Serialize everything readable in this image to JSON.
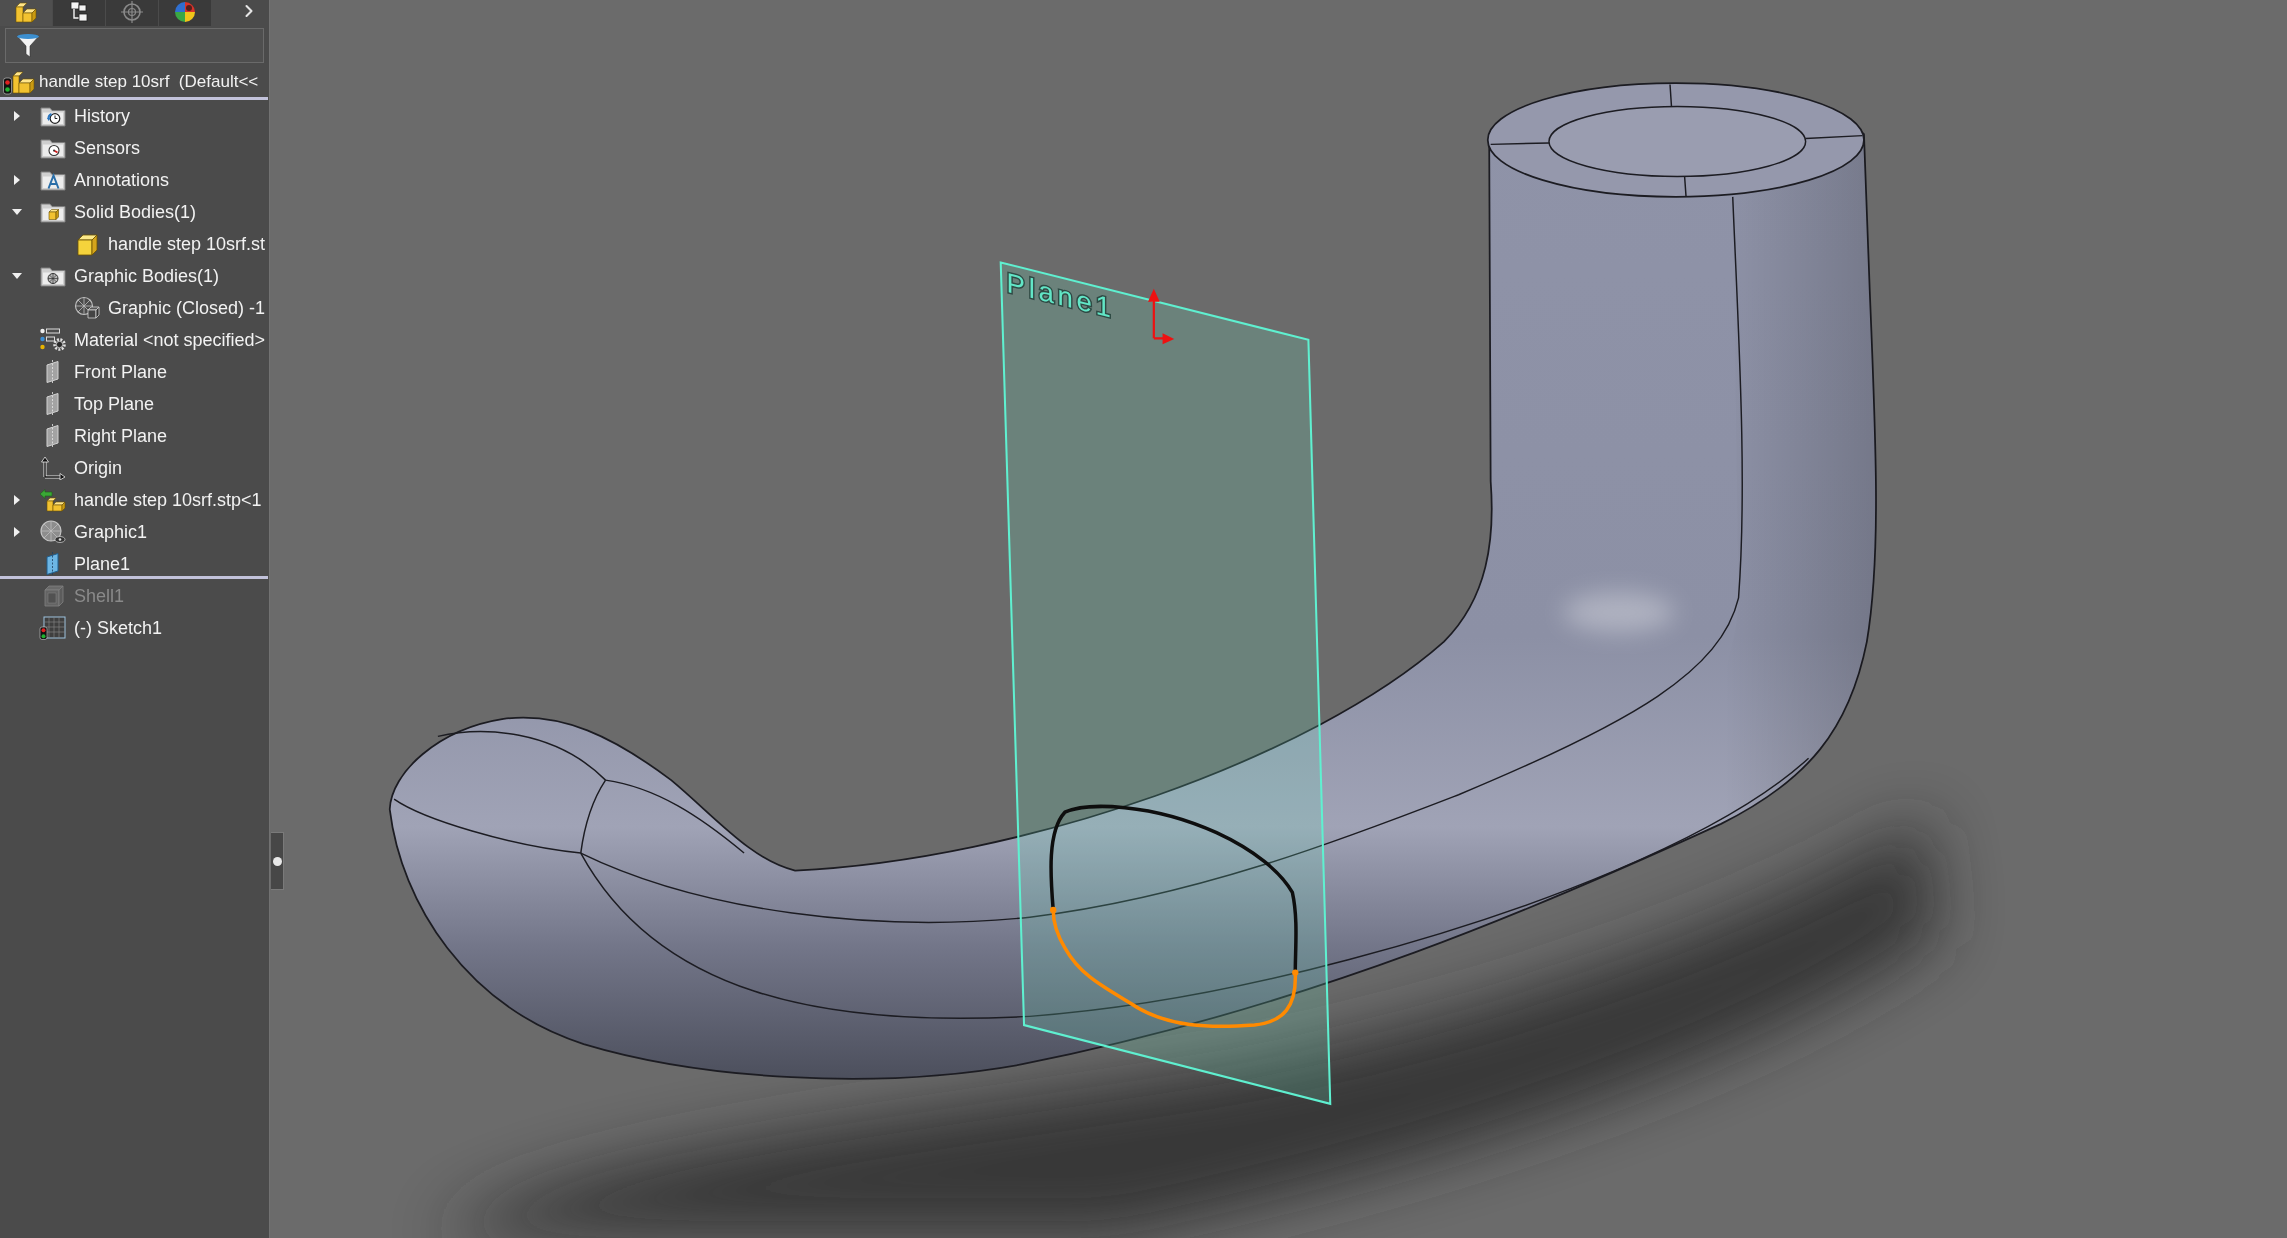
{
  "panel_tabs": [
    {
      "kind": "part",
      "selected": true
    },
    {
      "kind": "config",
      "selected": false
    },
    {
      "kind": "target",
      "selected": false
    },
    {
      "kind": "appearance",
      "selected": false
    }
  ],
  "tree": {
    "root": {
      "label": "handle step 10srf  (Default<<"
    },
    "items": [
      {
        "kind": "history",
        "label": "History",
        "expanded": false,
        "greyed": false
      },
      {
        "kind": "sensors",
        "label": "Sensors",
        "greyed": false
      },
      {
        "kind": "annotations",
        "label": "Annotations",
        "expanded": false,
        "greyed": false
      },
      {
        "kind": "solidbodies",
        "label": "Solid Bodies(1)",
        "expanded": true,
        "greyed": false,
        "children": [
          {
            "kind": "body",
            "label": "handle step 10srf.st",
            "greyed": false
          }
        ]
      },
      {
        "kind": "graphicbodies",
        "label": "Graphic Bodies(1)",
        "expanded": true,
        "greyed": false,
        "children": [
          {
            "kind": "graphicbody",
            "label": "Graphic (Closed) -1",
            "greyed": false
          }
        ]
      },
      {
        "kind": "material",
        "label": "Material <not specified>",
        "greyed": false
      },
      {
        "kind": "plane",
        "label": "Front Plane",
        "greyed": false
      },
      {
        "kind": "plane",
        "label": "Top Plane",
        "greyed": false
      },
      {
        "kind": "plane",
        "label": "Right Plane",
        "greyed": false
      },
      {
        "kind": "origin",
        "label": "Origin",
        "greyed": false
      },
      {
        "kind": "part",
        "label": "handle step 10srf.stp<1",
        "expanded": false,
        "greyed": false
      },
      {
        "kind": "graphic",
        "label": "Graphic1",
        "expanded": false,
        "greyed": false
      },
      {
        "kind": "refplane",
        "label": "Plane1",
        "greyed": false
      },
      {
        "kind": "rollback"
      },
      {
        "kind": "shell",
        "label": "Shell1",
        "greyed": true
      },
      {
        "kind": "sketch",
        "label": "(-) Sketch1",
        "greyed": false
      }
    ]
  },
  "viewport": {
    "plane_label": "Plane1"
  }
}
